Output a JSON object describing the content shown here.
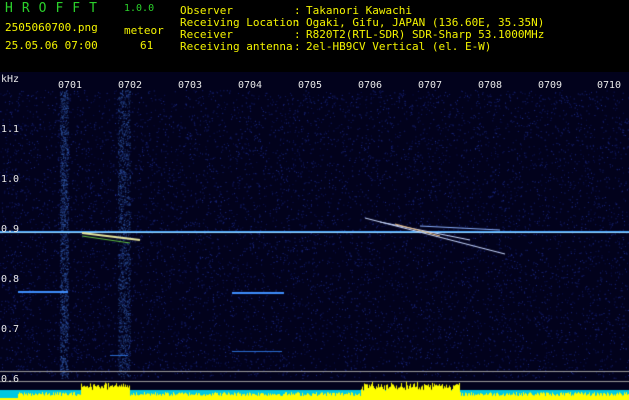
{
  "header": {
    "app_name": "HROFFT",
    "app_version": "1.0.0",
    "file_name": "2505060700.png",
    "timestamp": "25.05.06 07:00",
    "meteor_label": "meteor",
    "meteor_count": "61",
    "info": [
      {
        "label": "Observer",
        "value": "Takanori Kawachi"
      },
      {
        "label": "Receiving Location",
        "value": "Ogaki, Gifu, JAPAN (136.60E, 35.35N)"
      },
      {
        "label": "Receiver",
        "value": "R820T2(RTL-SDR) SDR-Sharp 53.1000MHz"
      },
      {
        "label": "Receiving antenna",
        "value": "2el-HB9CV Vertical (el. E-W)"
      }
    ],
    "separator": ":"
  },
  "axes": {
    "y_unit": "kHz",
    "y_ticks": [
      "1.1",
      "1.0",
      "0.9",
      "0.8",
      "0.7",
      "0.6"
    ],
    "x_ticks": [
      "0701",
      "0702",
      "0703",
      "0704",
      "0705",
      "0706",
      "0707",
      "0708",
      "0709",
      "0710"
    ]
  },
  "colors": {
    "header_green": "#2bd12b",
    "header_yellow": "#f3f300",
    "background": "#02021c",
    "carrier": "#4aa8ff",
    "meteor_trace": "#e8e8a0",
    "activity_bar": "#ffff00"
  }
}
